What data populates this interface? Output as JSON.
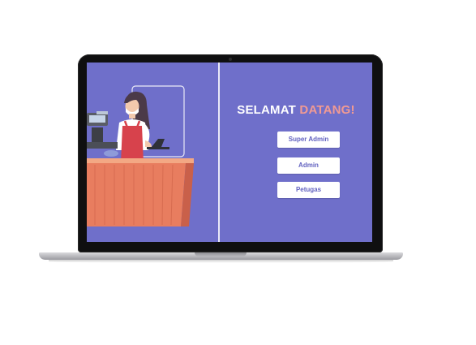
{
  "welcome": {
    "prefix": "SELAMAT",
    "highlight": "DATANG!"
  },
  "menu": {
    "buttons": [
      {
        "label": "Super Admin"
      },
      {
        "label": "Admin"
      },
      {
        "label": "Petugas"
      }
    ]
  },
  "colors": {
    "screen_background": "#6f6fca",
    "welcome_accent": "#f19a93",
    "button_text": "#6262c0",
    "counter": "#e87d5f"
  },
  "illustration": {
    "subject": "cashier-behind-counter",
    "icons": [
      "cashier-illustration",
      "cash-register-icon",
      "laptop-icon"
    ]
  }
}
